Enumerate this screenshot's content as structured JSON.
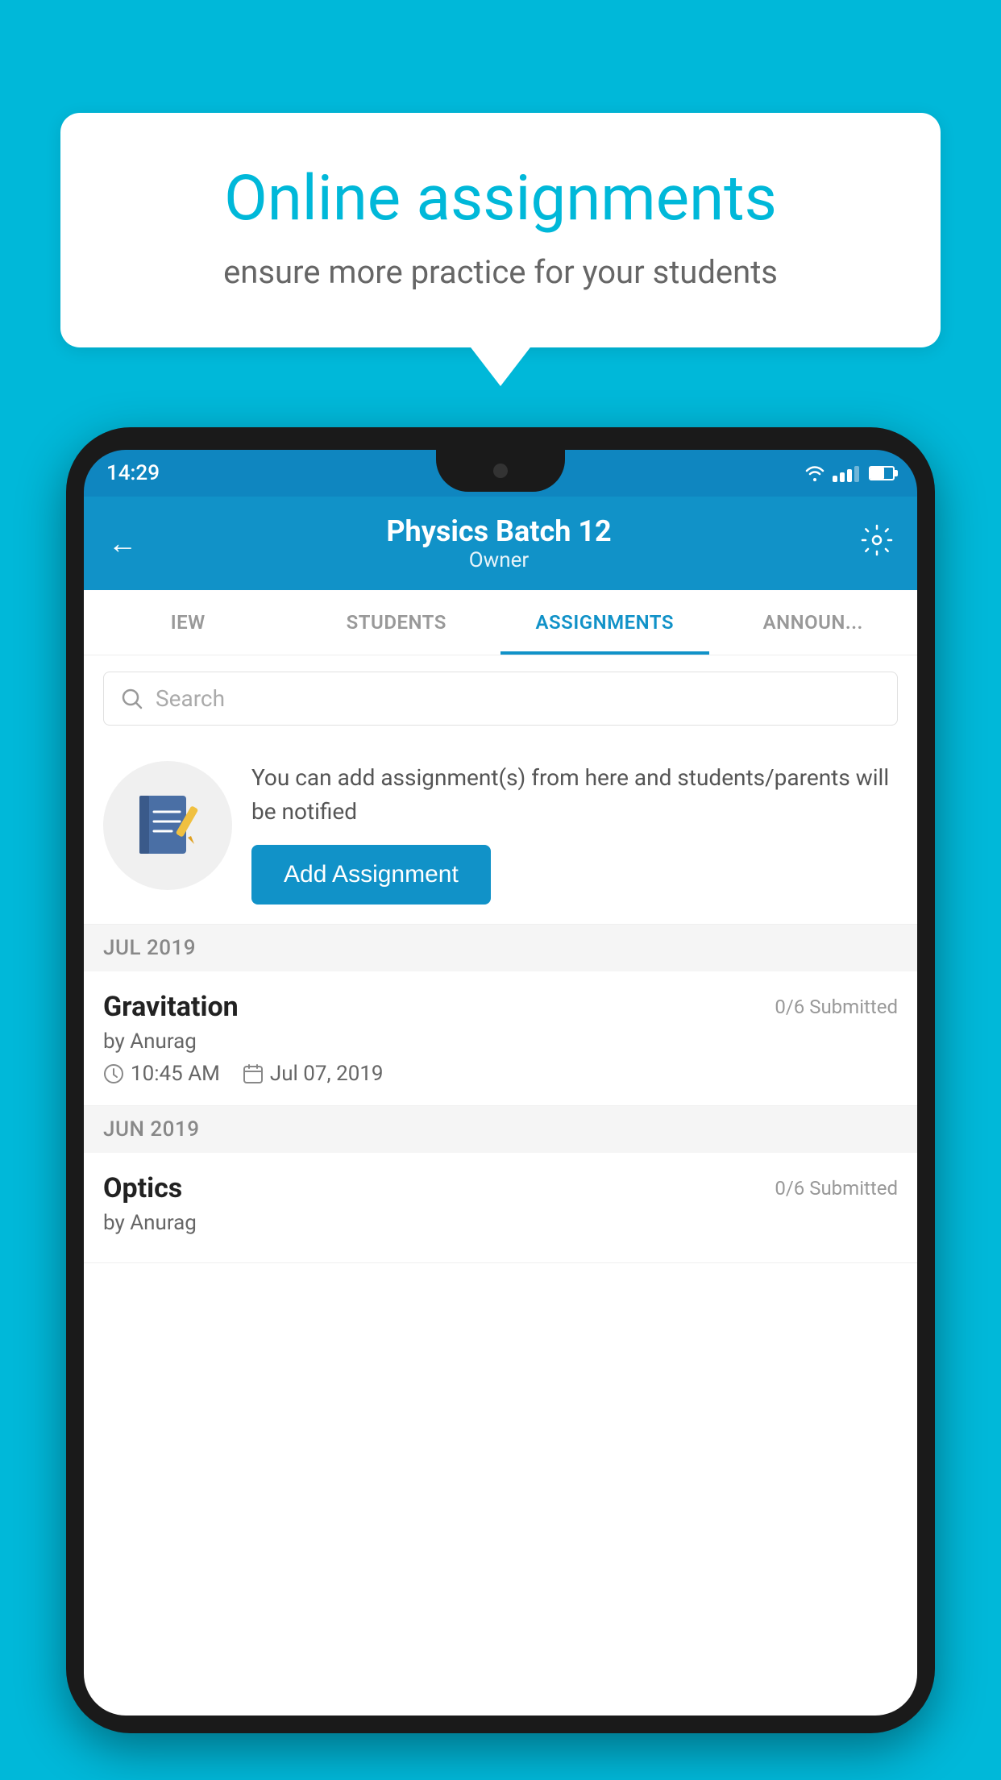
{
  "background": {
    "color": "#00B8D9"
  },
  "speech_bubble": {
    "title": "Online assignments",
    "subtitle": "ensure more practice for your students"
  },
  "phone": {
    "status_bar": {
      "time": "14:29"
    },
    "header": {
      "title": "Physics Batch 12",
      "subtitle": "Owner",
      "back_label": "←",
      "settings_label": "⚙"
    },
    "tabs": [
      {
        "label": "IEW",
        "active": false
      },
      {
        "label": "STUDENTS",
        "active": false
      },
      {
        "label": "ASSIGNMENTS",
        "active": true
      },
      {
        "label": "ANNOUNCE",
        "active": false
      }
    ],
    "search": {
      "placeholder": "Search"
    },
    "promo": {
      "description": "You can add assignment(s) from here and students/parents will be notified",
      "button_label": "Add Assignment"
    },
    "sections": [
      {
        "month_label": "JUL 2019",
        "assignments": [
          {
            "title": "Gravitation",
            "submitted": "0/6 Submitted",
            "by": "by Anurag",
            "time": "10:45 AM",
            "date": "Jul 07, 2019"
          }
        ]
      },
      {
        "month_label": "JUN 2019",
        "assignments": [
          {
            "title": "Optics",
            "submitted": "0/6 Submitted",
            "by": "by Anurag",
            "time": "",
            "date": ""
          }
        ]
      }
    ]
  }
}
